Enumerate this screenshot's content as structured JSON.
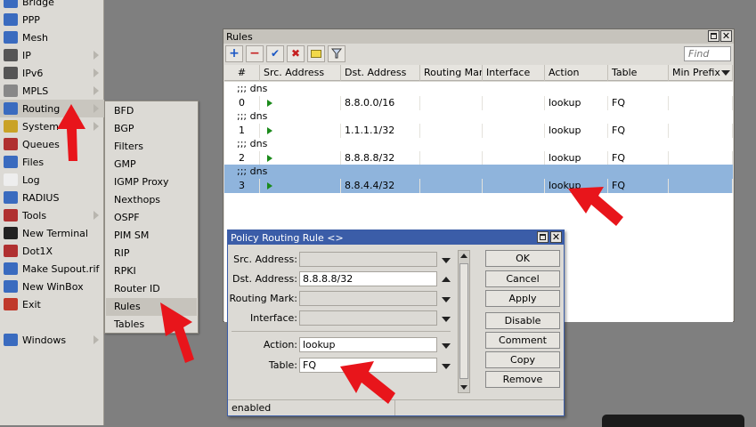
{
  "sidebar": {
    "items": [
      {
        "label": "Bridge",
        "icon": "bridge-icon",
        "color": "#3a6bbf",
        "sub": false
      },
      {
        "label": "PPP",
        "icon": "ppp-icon",
        "color": "#3a6bbf",
        "sub": false
      },
      {
        "label": "Mesh",
        "icon": "mesh-icon",
        "color": "#3a6bbf",
        "sub": false
      },
      {
        "label": "IP",
        "icon": "ip-icon",
        "color": "#555",
        "sub": true
      },
      {
        "label": "IPv6",
        "icon": "ipv6-icon",
        "color": "#555",
        "sub": true
      },
      {
        "label": "MPLS",
        "icon": "mpls-icon",
        "color": "#888",
        "sub": true
      },
      {
        "label": "Routing",
        "icon": "routing-icon",
        "color": "#3a6bbf",
        "sub": true
      },
      {
        "label": "System",
        "icon": "gear-icon",
        "color": "#c9a227",
        "sub": true
      },
      {
        "label": "Queues",
        "icon": "queues-icon",
        "color": "#b03030",
        "sub": false
      },
      {
        "label": "Files",
        "icon": "folder-icon",
        "color": "#3a6bbf",
        "sub": false
      },
      {
        "label": "Log",
        "icon": "log-icon",
        "color": "#eee",
        "sub": false
      },
      {
        "label": "RADIUS",
        "icon": "radius-icon",
        "color": "#3a6bbf",
        "sub": false
      },
      {
        "label": "Tools",
        "icon": "tools-icon",
        "color": "#b03030",
        "sub": true
      },
      {
        "label": "New Terminal",
        "icon": "terminal-icon",
        "color": "#222",
        "sub": false
      },
      {
        "label": "Dot1X",
        "icon": "dot1x-icon",
        "color": "#b03030",
        "sub": false
      },
      {
        "label": "Make Supout.rif",
        "icon": "supout-icon",
        "color": "#3a6bbf",
        "sub": false
      },
      {
        "label": "New WinBox",
        "icon": "winbox-icon",
        "color": "#3a6bbf",
        "sub": false
      },
      {
        "label": "Exit",
        "icon": "exit-icon",
        "color": "#c0392b",
        "sub": false
      }
    ],
    "windows_label": "Windows"
  },
  "submenu": {
    "items": [
      "BFD",
      "BGP",
      "Filters",
      "GMP",
      "IGMP Proxy",
      "Nexthops",
      "OSPF",
      "PIM SM",
      "RIP",
      "RPKI",
      "Router ID",
      "Rules",
      "Tables"
    ]
  },
  "rules_window": {
    "title": "Rules",
    "find_placeholder": "Find",
    "toolbar": {
      "add": "+",
      "remove": "−",
      "enable": "✔",
      "disable": "✖",
      "comment": "▭",
      "filter": "⊻"
    },
    "columns": [
      "#",
      "Src. Address",
      "Dst. Address",
      "Routing Mark",
      "Interface",
      "Action",
      "Table",
      "Min Prefix"
    ],
    "rows": [
      {
        "comment": ";;; dns",
        "num": "0",
        "src": "",
        "dst": "8.8.0.0/16",
        "mark": "",
        "iface": "",
        "action": "lookup",
        "table": "FQ"
      },
      {
        "comment": ";;; dns",
        "num": "1",
        "src": "",
        "dst": "1.1.1.1/32",
        "mark": "",
        "iface": "",
        "action": "lookup",
        "table": "FQ"
      },
      {
        "comment": ";;; dns",
        "num": "2",
        "src": "",
        "dst": "8.8.8.8/32",
        "mark": "",
        "iface": "",
        "action": "lookup",
        "table": "FQ"
      },
      {
        "comment": ";;; dns",
        "num": "3",
        "src": "",
        "dst": "8.8.4.4/32",
        "mark": "",
        "iface": "",
        "action": "lookup",
        "table": "FQ"
      }
    ]
  },
  "dialog": {
    "title": "Policy Routing Rule <>",
    "fields": {
      "src_label": "Src. Address:",
      "src_value": "",
      "dst_label": "Dst. Address:",
      "dst_value": "8.8.8.8/32",
      "mark_label": "Routing Mark:",
      "mark_value": "",
      "iface_label": "Interface:",
      "iface_value": "",
      "action_label": "Action:",
      "action_value": "lookup",
      "table_label": "Table:",
      "table_value": "FQ"
    },
    "buttons": {
      "ok": "OK",
      "cancel": "Cancel",
      "apply": "Apply",
      "disable": "Disable",
      "comment": "Comment",
      "copy": "Copy",
      "remove": "Remove"
    },
    "status": "enabled"
  },
  "colors": {
    "selection": "#8fb4dc",
    "titlebar_active": "#3b5da8",
    "annotation_arrow": "#e8151b"
  }
}
